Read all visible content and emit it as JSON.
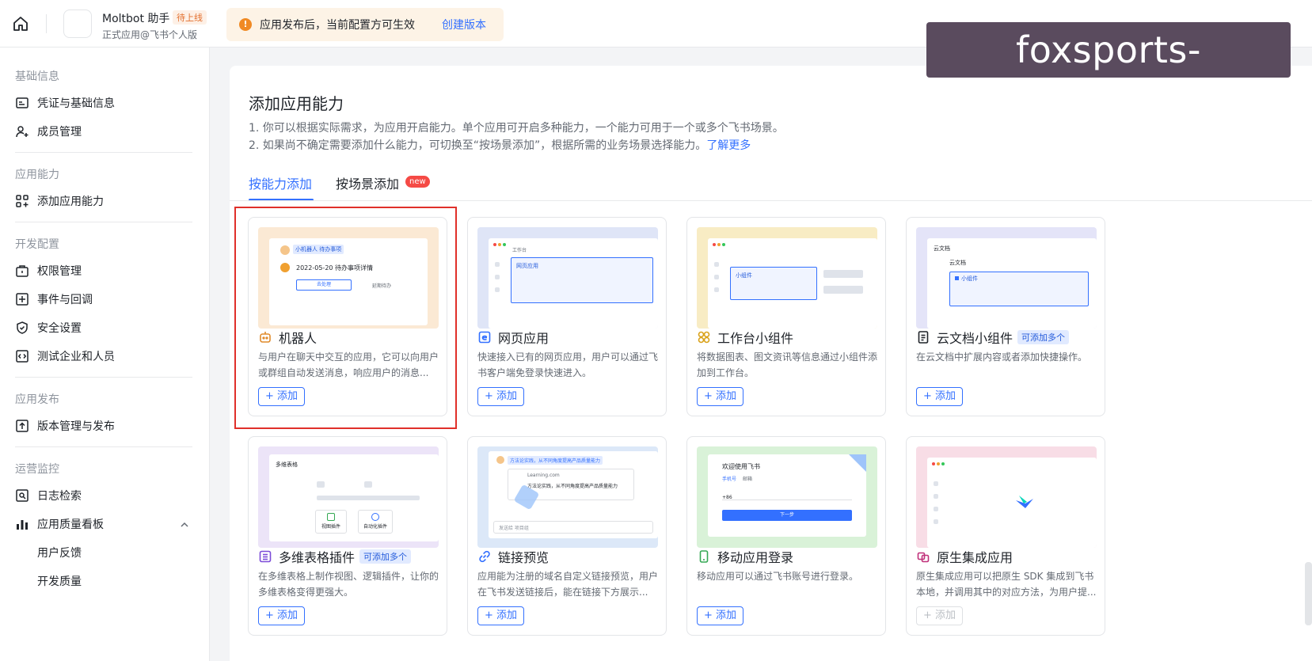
{
  "topbar": {
    "app_name": "Moltbot 助手",
    "app_badge": "待上线",
    "app_sub": "正式应用@飞书个人版",
    "notice_text": "应用发布后，当前配置方可生效",
    "notice_link": "创建版本"
  },
  "watermark": "foxsports-login.com",
  "sidebar": {
    "sections": [
      {
        "title": "基础信息",
        "items": [
          "凭证与基础信息",
          "成员管理"
        ]
      },
      {
        "title": "应用能力",
        "items": [
          "添加应用能力"
        ]
      },
      {
        "title": "开发配置",
        "items": [
          "权限管理",
          "事件与回调",
          "安全设置",
          "测试企业和人员"
        ]
      },
      {
        "title": "应用发布",
        "items": [
          "版本管理与发布"
        ]
      },
      {
        "title": "运营监控",
        "items": [
          "日志检索",
          "应用质量看板"
        ]
      }
    ],
    "subitems": [
      "用户反馈",
      "开发质量"
    ]
  },
  "main": {
    "title": "添加应用能力",
    "desc1": "1. 你可以根据实际需求，为应用开启能力。单个应用可开启多种能力，一个能力可用于一个或多个飞书场景。",
    "desc2": "2. 如果尚不确定需要添加什么能力，可切换至“按场景添加”，根据所需的业务场景选择能力。",
    "desc2_link": "了解更多",
    "tabs": [
      {
        "label": "按能力添加",
        "active": true
      },
      {
        "label": "按场景添加",
        "badge": "new"
      }
    ],
    "add_label": "+ 添加",
    "cards": [
      {
        "title": "机器人",
        "desc": "与用户在聊天中交互的应用，它可以向用户或群组自动发送消息，响应用户的消息...",
        "icon": "robot-icon",
        "image": {
          "chat_name": "小机器人 待办事项",
          "date": "2022-05-20 待办事项详情",
          "btn1": "去处理",
          "btn2": "延期待办"
        }
      },
      {
        "title": "网页应用",
        "desc": "快速接入已有的网页应用，用户可以通过飞书客户端免登录快速进入。",
        "icon": "web-icon",
        "image": {
          "tab": "工作台",
          "label": "网页应用"
        }
      },
      {
        "title": "工作台小组件",
        "desc": "将数据图表、图文资讯等信息通过小组件添加到工作台。",
        "icon": "widget-icon",
        "image": {
          "label": "小组件"
        }
      },
      {
        "title": "云文档小组件",
        "tag": "可添加多个",
        "desc": "在云文档中扩展内容或者添加快捷操作。",
        "icon": "doc-icon",
        "image": {
          "crumb": "云文档",
          "heading": "云文档",
          "label": "小组件"
        }
      },
      {
        "title": "多维表格插件",
        "tag": "可添加多个",
        "desc": "在多维表格上制作视图、逻辑插件，让你的多维表格变得更强大。",
        "icon": "bitable-icon",
        "image": {
          "crumb": "多维表格",
          "p1": "视图插件",
          "p2": "自动化插件"
        }
      },
      {
        "title": "链接预览",
        "desc": "应用能为注册的域名自定义链接预览，用户在飞书发送链接后，能在链接下方展示...",
        "icon": "link-icon",
        "image": {
          "msg": "方法论实践，从不同角度提高产品质量能力",
          "url": "Learning.com",
          "preview": "方法论实践，从不同角度提高产品质量能力",
          "input": "发送给 项目组"
        }
      },
      {
        "title": "移动应用登录",
        "desc": "移动应用可以通过飞书账号进行登录。",
        "icon": "mobile-icon",
        "image": {
          "heading": "欢迎使用飞书",
          "tab1": "手机号",
          "tab2": "邮箱",
          "code": "+86",
          "btn": "下一步"
        }
      },
      {
        "title": "原生集成应用",
        "desc": "原生集成应用可以把原生 SDK 集成到飞书本地，并调用其中的对应方法，为用户提...",
        "icon": "native-icon",
        "disabled": true
      }
    ]
  },
  "colors": {
    "accent": "#3370ff",
    "warning": "#f08a24",
    "highlight": "#e0302a",
    "badge_new": "#f54a45"
  }
}
